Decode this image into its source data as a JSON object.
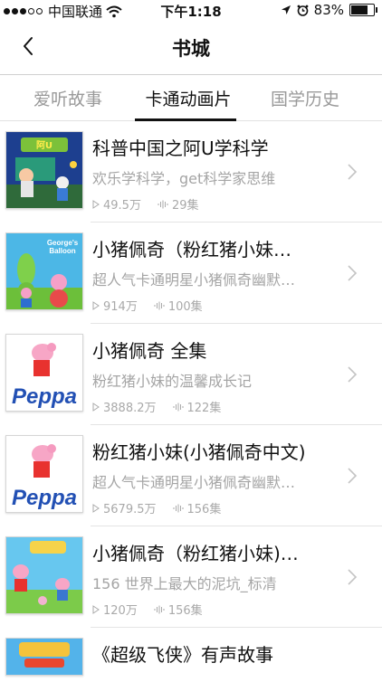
{
  "status_bar": {
    "carrier": "中国联通",
    "time": "下午1:18",
    "battery": "83%",
    "battery_level": 0.83
  },
  "nav": {
    "title": "书城",
    "back_icon": "chevron-left-icon"
  },
  "tabs": [
    {
      "label": "爱听故事",
      "active": false
    },
    {
      "label": "卡通动画片",
      "active": true
    },
    {
      "label": "国学历史",
      "active": false
    }
  ],
  "items": [
    {
      "title": "科普中国之阿U学科学",
      "subtitle": "欢乐学科学，get科学家思维",
      "plays": "49.5万",
      "episodes": "29集"
    },
    {
      "title": "小猪佩奇（粉红猪小妹…",
      "subtitle": "超人气卡通明星小猪佩奇幽默…",
      "plays": "914万",
      "episodes": "100集"
    },
    {
      "title": "小猪佩奇 全集",
      "subtitle": "粉红猪小妹的温馨成长记",
      "plays": "3888.2万",
      "episodes": "122集"
    },
    {
      "title": "粉红猪小妹(小猪佩奇中文)",
      "subtitle": "超人气卡通明星小猪佩奇幽默…",
      "plays": "5679.5万",
      "episodes": "156集"
    },
    {
      "title": "小猪佩奇（粉红猪小妹)…",
      "subtitle": "156 世界上最大的泥坑_标清",
      "plays": "120万",
      "episodes": "156集"
    },
    {
      "title": "《超级飞侠》有声故事",
      "subtitle": "",
      "plays": "",
      "episodes": ""
    }
  ],
  "thumb_text": {
    "george": "George's Balloon",
    "peppa": "Peppa Pig"
  }
}
